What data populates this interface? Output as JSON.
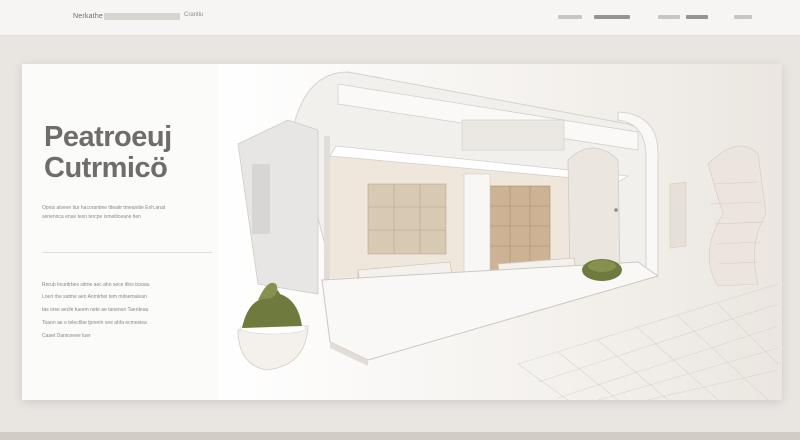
{
  "topbar": {
    "brand": "Nerkathe",
    "link_short": "Crantiu",
    "nav_items": [
      "",
      "",
      "",
      ""
    ],
    "icons": [
      "search-icon"
    ]
  },
  "hero": {
    "title_line1": "Peatroeuj",
    "title_line2": "Cutrmicö",
    "subtitle_lines": [
      "Opnis atveve tiur hacorantiee titeaitr tmeanitie Enh.anat",
      "seriennca enue tesn tercpe ixmeiticeane tien"
    ],
    "body_lines": [
      "Rnrub Incettrbes sitme aec ahn sece itlos ticeaiu",
      "Loeri rbe satme aen Anmirhei tem mitsemalean",
      "tas orse aecfe tueem nete ae tanenon Taerdeau",
      "Toaon ae o telectibe tpnerin see ahfa ecmesiea",
      "Caaet Daniceeee tuer"
    ]
  },
  "colors": {
    "accent": "#6f6c69",
    "plant": "#6f7a3e",
    "background": "#e9e6e2",
    "card": "#ffffff"
  }
}
